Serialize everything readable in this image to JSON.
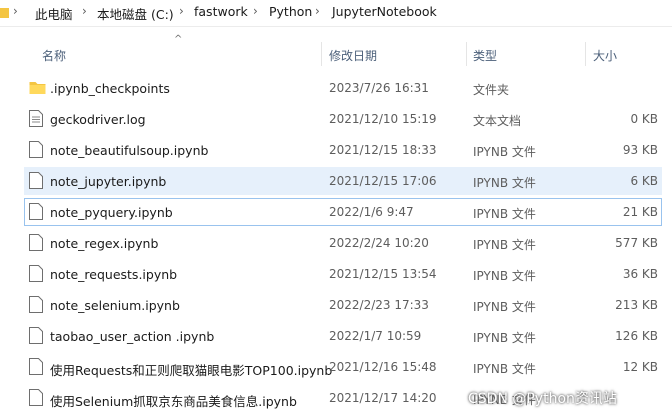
{
  "breadcrumb": [
    "此电脑",
    "本地磁盘 (C:)",
    "fastwork",
    "Python",
    "JupyterNotebook"
  ],
  "columns": {
    "name": "名称",
    "date": "修改日期",
    "type": "类型",
    "size": "大小"
  },
  "files": [
    {
      "name": ".ipynb_checkpoints",
      "date": "2023/7/26 16:31",
      "type": "文件夹",
      "size": "",
      "icon": "folder-icon"
    },
    {
      "name": "geckodriver.log",
      "date": "2021/12/10 15:19",
      "type": "文本文档",
      "size": "0 KB",
      "icon": "text-file-icon"
    },
    {
      "name": "note_beautifulsoup.ipynb",
      "date": "2021/12/15 18:33",
      "type": "IPYNB 文件",
      "size": "93 KB",
      "icon": "file-icon"
    },
    {
      "name": "note_jupyter.ipynb",
      "date": "2021/12/15 17:06",
      "type": "IPYNB 文件",
      "size": "6 KB",
      "icon": "file-icon"
    },
    {
      "name": "note_pyquery.ipynb",
      "date": "2022/1/6 9:47",
      "type": "IPYNB 文件",
      "size": "21 KB",
      "icon": "file-icon"
    },
    {
      "name": "note_regex.ipynb",
      "date": "2022/2/24 10:20",
      "type": "IPYNB 文件",
      "size": "577 KB",
      "icon": "file-icon"
    },
    {
      "name": "note_requests.ipynb",
      "date": "2021/12/15 13:54",
      "type": "IPYNB 文件",
      "size": "36 KB",
      "icon": "file-icon"
    },
    {
      "name": "note_selenium.ipynb",
      "date": "2022/2/23 17:33",
      "type": "IPYNB 文件",
      "size": "213 KB",
      "icon": "file-icon"
    },
    {
      "name": "taobao_user_action .ipynb",
      "date": "2022/1/7 10:59",
      "type": "IPYNB 文件",
      "size": "126 KB",
      "icon": "file-icon"
    },
    {
      "name": "使用Requests和正则爬取猫眼电影TOP100.ipynb",
      "date": "2021/12/16 15:48",
      "type": "IPYNB 文件",
      "size": "12 KB",
      "icon": "file-icon"
    },
    {
      "name": "使用Selenium抓取京东商品美食信息.ipynb",
      "date": "2021/12/17 14:20",
      "type": "IPYNB 文件",
      "size": "",
      "icon": "file-icon"
    }
  ],
  "watermark": "CSDN @Python资讯站",
  "colors": {
    "hover": "#e6f0fb",
    "focus_border": "#99c3ee",
    "folder": "#f4c542",
    "header_text": "#4c607a"
  }
}
